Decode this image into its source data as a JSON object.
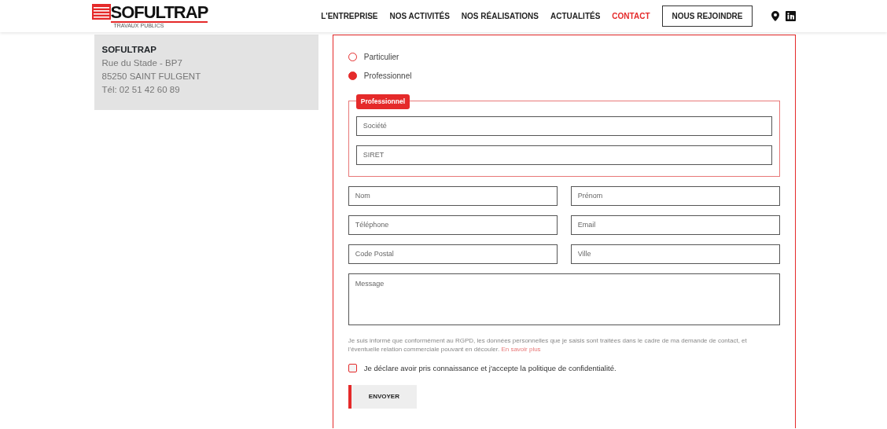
{
  "header": {
    "logo": {
      "name": "SOFULTRAP",
      "tagline": "TRAVAUX PUBLICS"
    },
    "nav": [
      {
        "label": "L'ENTREPRISE",
        "selected": false
      },
      {
        "label": "NOS ACTIVITÉS",
        "selected": false
      },
      {
        "label": "NOS RÉALISATIONS",
        "selected": false
      },
      {
        "label": "ACTUALITÉS",
        "selected": false
      },
      {
        "label": "CONTACT",
        "selected": true
      }
    ],
    "cta": "NOUS REJOINDRE"
  },
  "address": {
    "name": "SOFULTRAP",
    "lines": [
      "Rue du Stade - BP7",
      "85250 SAINT FULGENT",
      "Tél: 02 51 42 60 89"
    ]
  },
  "form": {
    "customer_types": [
      {
        "label": "Particulier",
        "selected": false
      },
      {
        "label": "Professionnel",
        "selected": true
      }
    ],
    "company_group": {
      "legend": "Professionnel",
      "fields": [
        {
          "placeholder": "Société"
        },
        {
          "placeholder": "SIRET"
        }
      ]
    },
    "fields": [
      {
        "placeholder": "Nom"
      },
      {
        "placeholder": "Prénom"
      },
      {
        "placeholder": "Téléphone"
      },
      {
        "placeholder": "Email"
      },
      {
        "placeholder": "Code Postal"
      },
      {
        "placeholder": "Ville"
      }
    ],
    "message": {
      "placeholder": "Message"
    },
    "notice": "Je suis informé que conformément au RGPD, les données personnelles que je saisis sont traitées dans le cadre de ma demande de contact, et l'éventuelle relation commerciale pouvant en découler.",
    "notice_link": "En savoir plus",
    "consent": {
      "label": "Je déclare avoir pris connaissance et j'accepte la politique de confidentialité.",
      "checked": false
    },
    "submit": "ENVOYER"
  }
}
